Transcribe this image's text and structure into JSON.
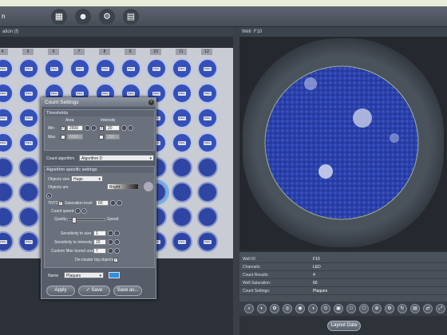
{
  "title_bar": {
    "app_title": "n"
  },
  "toolbar": {
    "icons": [
      "plate-icon",
      "people-icon",
      "gear-icon",
      "book-icon"
    ]
  },
  "left_panel": {
    "header": "ation (f)"
  },
  "right_panel": {
    "header": "Well",
    "well_id": "F10"
  },
  "plate": {
    "columns": [
      "4",
      "5",
      "6",
      "7",
      "8",
      "9",
      "10",
      "11",
      "12"
    ],
    "well_label": "WELL"
  },
  "count_settings": {
    "title": "Count Settings",
    "thresholds_label": "Thresholds",
    "col_area": "Area",
    "col_intensity": "Intensity",
    "min_label": "Min",
    "max_label": "Max",
    "min_area": "2500",
    "max_area": "5000",
    "min_intensity": "20",
    "max_intensity": "255",
    "count_algorithm_label": "Count algorithm",
    "count_algorithm_value": "Algorithm D",
    "specific_settings_label": "Algorithm specific settings",
    "objects_size_label": "Objects size",
    "objects_size_value": "Huge",
    "objects_are_label": "Objects are",
    "objects_are_value": "Bright",
    "tntc_label": "TNTC",
    "saturation_label": "Saturation level",
    "saturation_value": "60",
    "count_speed_label": "Count speed",
    "quality_label": "Quality",
    "speed_label": "Speed",
    "sens_size_label": "Sensitivity to size",
    "sens_size_value": "1",
    "sens_intensity_label": "Sensitivity to intensity",
    "sens_intensity_value": "15",
    "custom_filter_label": "Custom filter kernel size",
    "custom_filter_value": "7",
    "decluster_label": "De-cluster big objects",
    "name_label": "Name",
    "name_value": "Plaques",
    "apply_label": "Apply",
    "save_label": "Save",
    "saveas_label": "Save as..."
  },
  "info": {
    "rows": [
      {
        "k": "Well ID",
        "v": "F10"
      },
      {
        "k": "Channels:",
        "v": "LED"
      },
      {
        "k": "Count Results:",
        "v": "4"
      },
      {
        "k": "Well Saturation:",
        "v": "60"
      },
      {
        "k": "Count Settings:",
        "v": "Plaques"
      }
    ]
  },
  "layout_button": "Layout Data",
  "colors": {
    "well_blue": "#2f45a3",
    "selection": "#6fb4e8",
    "panel": "#565d68"
  }
}
